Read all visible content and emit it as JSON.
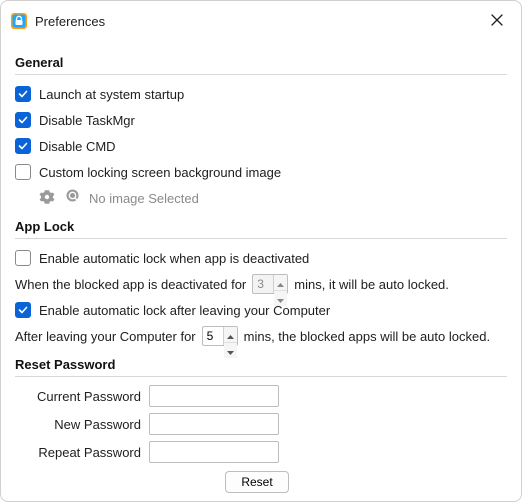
{
  "window": {
    "title": "Preferences"
  },
  "general": {
    "heading": "General",
    "launch_label": "Launch at system startup",
    "launch_checked": true,
    "taskmgr_label": "Disable TaskMgr",
    "taskmgr_checked": true,
    "cmd_label": "Disable CMD",
    "cmd_checked": true,
    "custom_bg_label": "Custom locking screen background image",
    "custom_bg_checked": false,
    "no_image_text": "No image Selected"
  },
  "applock": {
    "heading": "App Lock",
    "auto_deact_label": "Enable automatic lock when app is deactivated",
    "auto_deact_checked": false,
    "deact_prefix": "When the blocked app is deactivated for",
    "deact_value": "3",
    "deact_suffix": "mins, it will be auto locked.",
    "auto_leave_label": "Enable automatic lock after leaving your Computer",
    "auto_leave_checked": true,
    "leave_prefix": "After leaving your Computer for",
    "leave_value": "5",
    "leave_suffix": "mins, the blocked apps will be auto locked."
  },
  "reset": {
    "heading": "Reset Password",
    "current_label": "Current Password",
    "new_label": "New Password",
    "repeat_label": "Repeat Password",
    "button": "Reset"
  }
}
